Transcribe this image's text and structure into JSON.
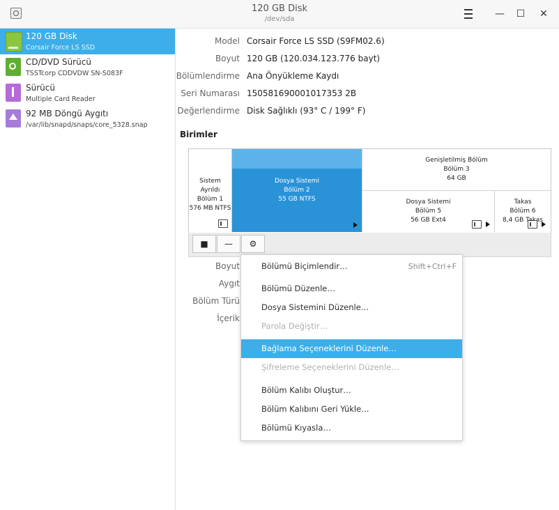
{
  "window": {
    "title": "120 GB Disk",
    "subtitle": "/dev/sda"
  },
  "sidebar": {
    "devices": [
      {
        "name": "120 GB Disk",
        "sub": "Corsair Force LS SSD",
        "icon": "ssd-drive-icon"
      },
      {
        "name": "CD/DVD Sürücü",
        "sub": "TSSTcorp CDDVDW SN-S083F",
        "icon": "optical-drive-icon"
      },
      {
        "name": "Sürücü",
        "sub": "Multiple Card  Reader",
        "icon": "usb-drive-icon"
      },
      {
        "name": "92 MB Döngü Aygıtı",
        "sub": "/var/lib/snapd/snaps/core_5328.snap",
        "icon": "loop-device-icon"
      }
    ]
  },
  "disk": {
    "model_label": "Model",
    "model": "Corsair Force LS SSD (S9FM02.6)",
    "size_label": "Boyut",
    "size": "120 GB (120.034.123.776 bayt)",
    "partitioning_label": "Bölümlendirme",
    "partitioning": "Ana Önyükleme Kaydı",
    "serial_label": "Seri Numarası",
    "serial": "150581690001017353 2B",
    "assessment_label": "Değerlendirme",
    "assessment": "Disk Sağlıklı (93° C / 199° F)"
  },
  "volumes": {
    "title": "Birimler",
    "partitions": [
      {
        "line1": "Sistem Ayrıldı",
        "line2": "Bölüm 1",
        "line3": "576 MB NTFS"
      },
      {
        "line1": "Dosya Sistemi",
        "line2": "Bölüm 2",
        "line3": "55 GB NTFS"
      },
      {
        "line1": "Genişletilmiş Bölüm",
        "line2": "Bölüm 3",
        "line3": "64 GB"
      },
      {
        "line1": "Dosya Sistemi",
        "line2": "Bölüm 5",
        "line3": "56 GB Ext4"
      },
      {
        "line1": "Takas",
        "line2": "Bölüm 6",
        "line3": "8,4 GB Takas"
      }
    ],
    "toolbar": {
      "stop_icon": "■",
      "remove_icon": "—",
      "settings_icon": "⚙"
    }
  },
  "partition_props": {
    "size_label": "Boyut",
    "device_label": "Aygıt",
    "type_label": "Bölüm Türü",
    "contents_label": "İçerik"
  },
  "context_menu": {
    "items": [
      {
        "label": "Bölümü Biçimlendir…",
        "shortcut": "Shift+Ctrl+F"
      },
      {
        "label": "Bölümü Düzenle…"
      },
      {
        "label": "Dosya Sistemini Düzenle…"
      },
      {
        "label": "Parola Değiştir…"
      },
      {
        "label": "Bağlama Seçeneklerini Düzenle…"
      },
      {
        "label": "Şifreleme Seçeneklerini Düzenle…"
      },
      {
        "label": "Bölüm Kalıbı Oluştur…"
      },
      {
        "label": "Bölüm Kalıbını Geri Yükle…"
      },
      {
        "label": "Bölümü Kıyasla…"
      }
    ]
  },
  "colors": {
    "accent": "#3daee9",
    "selected_partition": "#2a93d8"
  }
}
